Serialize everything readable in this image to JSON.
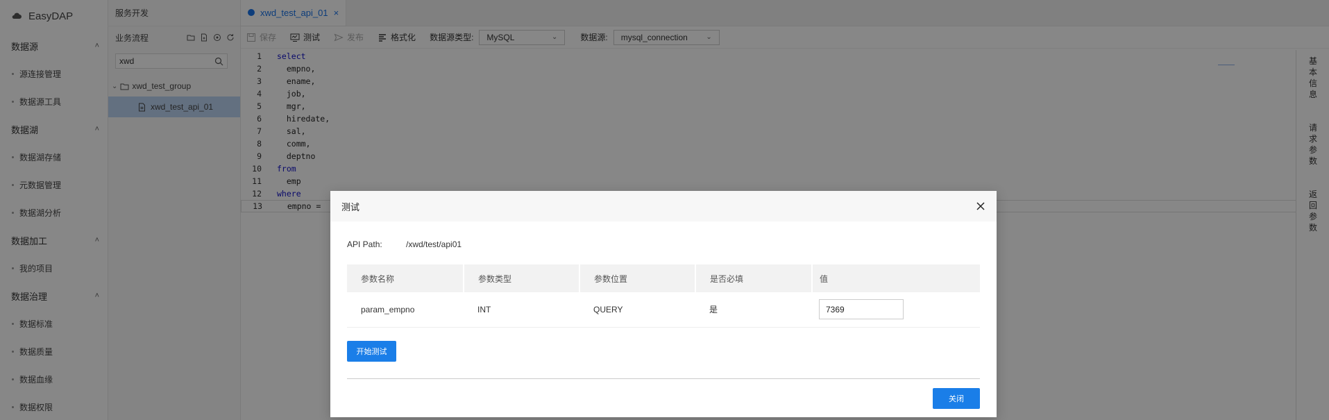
{
  "app": {
    "name": "EasyDAP"
  },
  "sidebar": {
    "groups": [
      {
        "label": "数据源",
        "items": [
          "源连接管理",
          "数据源工具"
        ]
      },
      {
        "label": "数据湖",
        "items": [
          "数据湖存储",
          "元数据管理",
          "数据湖分析"
        ]
      },
      {
        "label": "数据加工",
        "items": [
          "我的项目"
        ]
      },
      {
        "label": "数据治理",
        "items": [
          "数据标准",
          "数据质量",
          "数据血缘",
          "数据权限"
        ]
      }
    ]
  },
  "tree": {
    "header": "服务开发",
    "section": "业务流程",
    "search_value": "xwd",
    "group": "xwd_test_group",
    "leaf": "xwd_test_api_01"
  },
  "tabs": [
    {
      "label": "xwd_test_api_01",
      "close": "×"
    }
  ],
  "toolbar": {
    "save": "保存",
    "test": "测试",
    "publish": "发布",
    "format": "格式化",
    "ds_type_label": "数据源类型:",
    "ds_type_value": "MySQL",
    "ds_label": "数据源:",
    "ds_value": "mysql_connection"
  },
  "editor": {
    "lines": [
      {
        "n": "1",
        "kw": "select",
        "text": ""
      },
      {
        "n": "2",
        "kw": "",
        "text": "  empno,"
      },
      {
        "n": "3",
        "kw": "",
        "text": "  ename,"
      },
      {
        "n": "4",
        "kw": "",
        "text": "  job,"
      },
      {
        "n": "5",
        "kw": "",
        "text": "  mgr,"
      },
      {
        "n": "6",
        "kw": "",
        "text": "  hiredate,"
      },
      {
        "n": "7",
        "kw": "",
        "text": "  sal,"
      },
      {
        "n": "8",
        "kw": "",
        "text": "  comm,"
      },
      {
        "n": "9",
        "kw": "",
        "text": "  deptno"
      },
      {
        "n": "10",
        "kw": "from",
        "text": ""
      },
      {
        "n": "11",
        "kw": "",
        "text": "  emp"
      },
      {
        "n": "12",
        "kw": "where",
        "text": ""
      },
      {
        "n": "13",
        "kw": "",
        "text": "  empno = "
      }
    ]
  },
  "right_rail": [
    "基本信息",
    "请求参数",
    "返回参数"
  ],
  "modal": {
    "title": "测试",
    "api_path_label": "API Path:",
    "api_path_value": "/xwd/test/api01",
    "columns": [
      "参数名称",
      "参数类型",
      "参数位置",
      "是否必填",
      "值"
    ],
    "rows": [
      {
        "name": "param_empno",
        "type": "INT",
        "position": "QUERY",
        "required": "是",
        "value": "7369"
      }
    ],
    "start_test": "开始测试",
    "close": "关闭"
  }
}
